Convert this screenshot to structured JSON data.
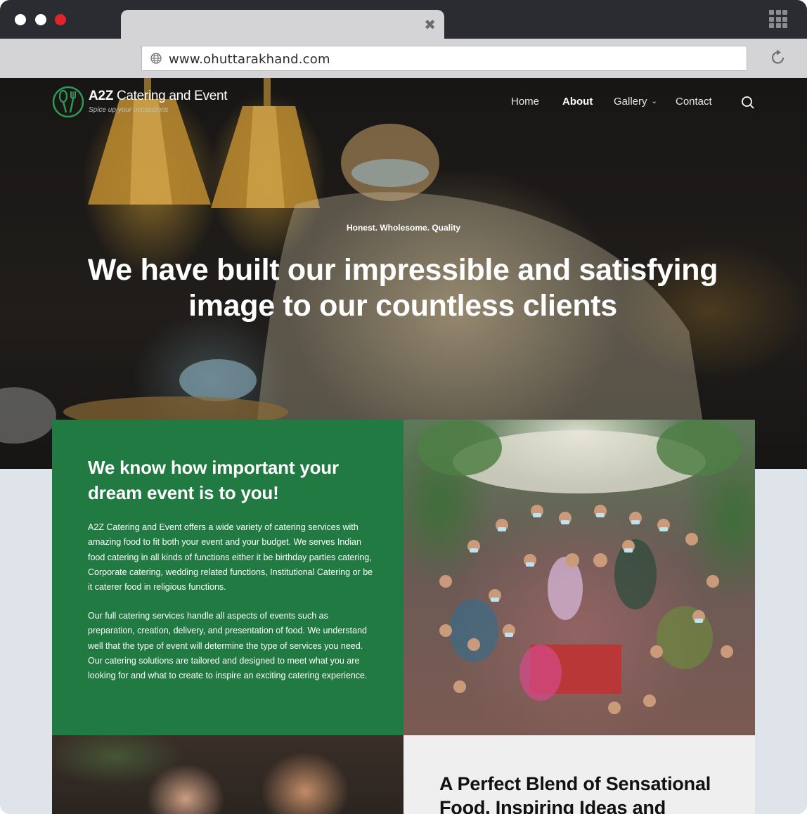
{
  "browser": {
    "url": "www.ohuttarakhand.com",
    "colors": {
      "close": "#e0242b",
      "minimize": "#ffffff",
      "maximize": "#ffffff"
    }
  },
  "header": {
    "logo_title_bold": "A2Z",
    "logo_title_rest": " Catering and Event",
    "logo_tagline": "Spice up your occassions",
    "nav": [
      {
        "label": "Home"
      },
      {
        "label": "About"
      },
      {
        "label": "Gallery"
      },
      {
        "label": "Contact"
      }
    ]
  },
  "hero": {
    "kicker": "Honest.  Wholesome.  Quality",
    "headline_line1": "We have built our impressible and satisfying",
    "headline_line2": "image to our countless clients"
  },
  "intro": {
    "heading": "We know how important your dream event is to you!",
    "paragraph1": "A2Z Catering and Event offers a wide variety of catering services with amazing food to fit both your event and your budget. We serves Indian food catering in all kinds of functions either it be birthday parties catering, Corporate catering, wedding related functions, Institutional Catering or be it caterer food in religious functions.",
    "paragraph2": "Our full catering services handle all aspects of events such as preparation, creation, delivery, and presentation of food. We understand well that the type of event will determine the type of services you need. Our catering solutions are tailored and designed to meet what you are looking for and what to create to inspire an exciting catering experience."
  },
  "blend": {
    "heading": "A Perfect Blend of Sensational Food, Inspiring Ideas and"
  },
  "colors": {
    "brand_green": "#207a41"
  },
  "icons": [
    "globe-icon",
    "reload-icon",
    "apps-grid-icon",
    "tab-close-icon",
    "logo-spoon-fork-icon",
    "chevron-down-icon",
    "search-icon"
  ]
}
